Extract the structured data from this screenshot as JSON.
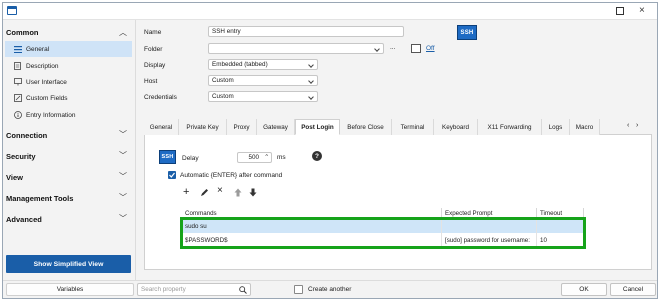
{
  "sidebar": {
    "sections": [
      {
        "label": "Common",
        "chevron": "chevron-up-icon"
      },
      {
        "label": "Connection",
        "chevron": "chevron-down-icon"
      },
      {
        "label": "Security",
        "chevron": "chevron-down-icon"
      },
      {
        "label": "View",
        "chevron": "chevron-down-icon"
      },
      {
        "label": "Management Tools",
        "chevron": "chevron-down-icon"
      },
      {
        "label": "Advanced",
        "chevron": "chevron-down-icon"
      }
    ],
    "common_items": [
      {
        "label": "General",
        "icon": "list-icon",
        "selected": true
      },
      {
        "label": "Description",
        "icon": "document-icon"
      },
      {
        "label": "User Interface",
        "icon": "monitor-icon"
      },
      {
        "label": "Custom Fields",
        "icon": "edit-field-icon"
      },
      {
        "label": "Entry Information",
        "icon": "info-icon"
      }
    ],
    "simplified_button": "Show Simplified View"
  },
  "form": {
    "name_label": "Name",
    "name_value": "SSH entry",
    "folder_label": "Folder",
    "folder_value": "",
    "folder_browse": "...",
    "off_link": "Off",
    "display_label": "Display",
    "display_value": "Embedded (tabbed)",
    "host_label": "Host",
    "host_value": "Custom",
    "credentials_label": "Credentials",
    "credentials_value": "Custom",
    "badge_text": "SSH"
  },
  "tabs": [
    "General",
    "Private Key",
    "Proxy",
    "Gateway",
    "Post Login",
    "Before Close",
    "Terminal",
    "Keyboard",
    "X11 Forwarding",
    "Logs",
    "Macro"
  ],
  "active_tab": "Post Login",
  "post_login": {
    "badge_text": "SSH",
    "delay_label": "Delay",
    "delay_value": "500",
    "delay_unit": "ms",
    "auto_enter_label": "Automatic {ENTER} after command",
    "auto_enter_checked": true
  },
  "table": {
    "headers": [
      "Commands",
      "Expected Prompt",
      "Timeout"
    ],
    "rows": [
      {
        "command": "sudo su",
        "prompt": "",
        "timeout": ""
      },
      {
        "command": "$PASSWORD$",
        "prompt": "[sudo] password for username:",
        "timeout": "10"
      }
    ],
    "highlight_color": "#16a31a"
  },
  "statusbar": {
    "variables_label": "Variables",
    "search_placeholder": "Search property",
    "create_another_label": "Create another",
    "ok_label": "OK",
    "cancel_label": "Cancel"
  },
  "colors": {
    "accent": "#1a5ea8",
    "selection": "#cfe3f7",
    "row_selected": "#cfe5f8"
  }
}
